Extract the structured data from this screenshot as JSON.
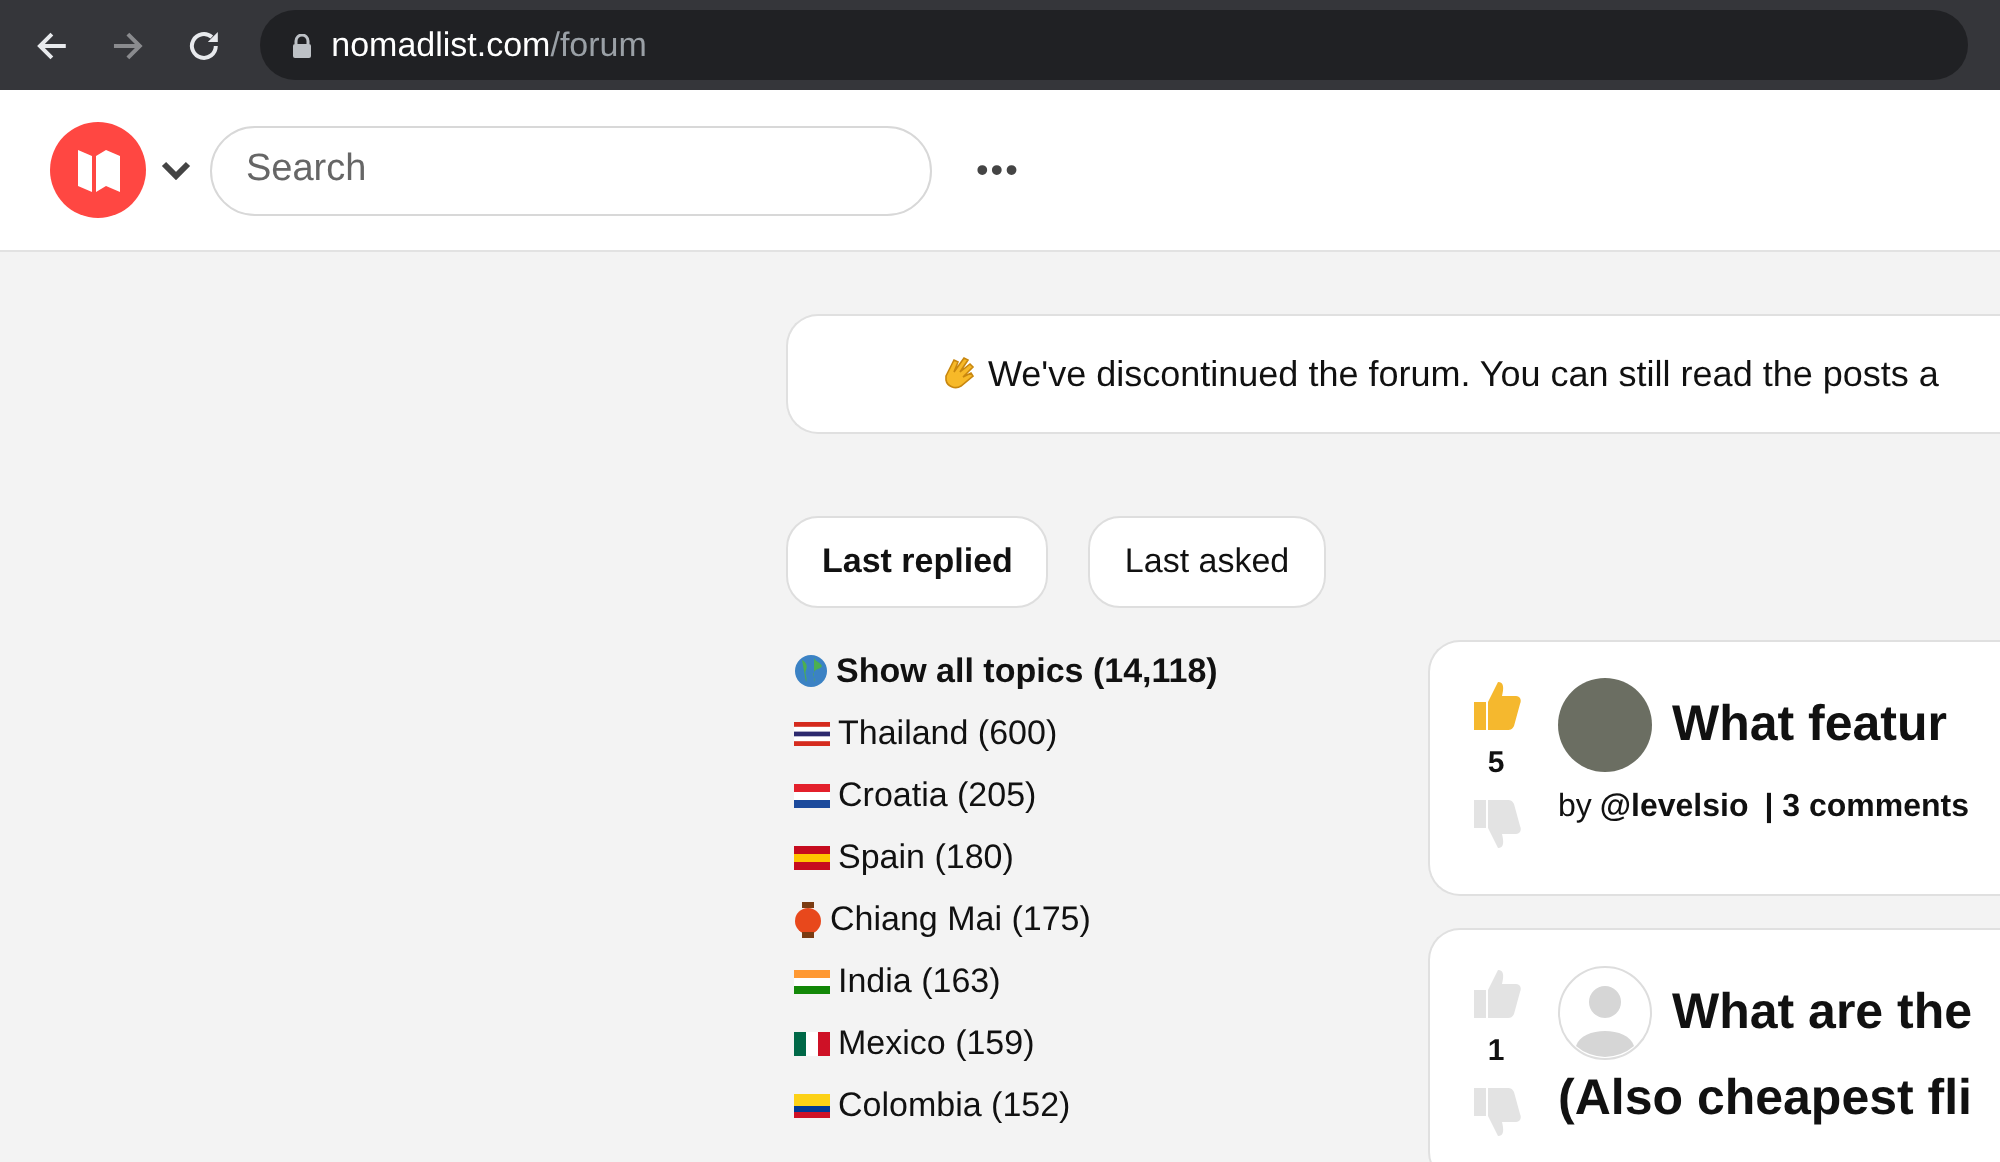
{
  "browser": {
    "url_host": "nomadlist.com",
    "url_path": "/forum"
  },
  "header": {
    "search": {
      "placeholder": "Search"
    },
    "more_button": "•••"
  },
  "banner": {
    "text": "We've discontinued the forum. You can still read the posts a"
  },
  "sort_tabs": [
    {
      "label": "Last replied",
      "selected": true
    },
    {
      "label": "Last asked",
      "selected": false
    }
  ],
  "topics": [
    {
      "label": "Show all topics (14,118)",
      "kind": "globe",
      "selected": true
    },
    {
      "label": "Thailand (600)",
      "kind": "th",
      "selected": false
    },
    {
      "label": "Croatia (205)",
      "kind": "hr",
      "selected": false
    },
    {
      "label": "Spain (180)",
      "kind": "es",
      "selected": false
    },
    {
      "label": "Chiang Mai (175)",
      "kind": "lantern",
      "selected": false
    },
    {
      "label": "India (163)",
      "kind": "in",
      "selected": false
    },
    {
      "label": "Mexico (159)",
      "kind": "mx",
      "selected": false
    },
    {
      "label": "Colombia (152)",
      "kind": "co",
      "selected": false
    }
  ],
  "posts": [
    {
      "votes": "5",
      "liked": true,
      "kind": "photo",
      "title_lines": [
        "What featur"
      ],
      "by_label": "by",
      "author": "@levelsio",
      "comments": "| 3 comments"
    },
    {
      "votes": "1",
      "liked": false,
      "kind": "default",
      "title_lines": [
        "What are the",
        "(Also cheapest fli"
      ]
    }
  ]
}
